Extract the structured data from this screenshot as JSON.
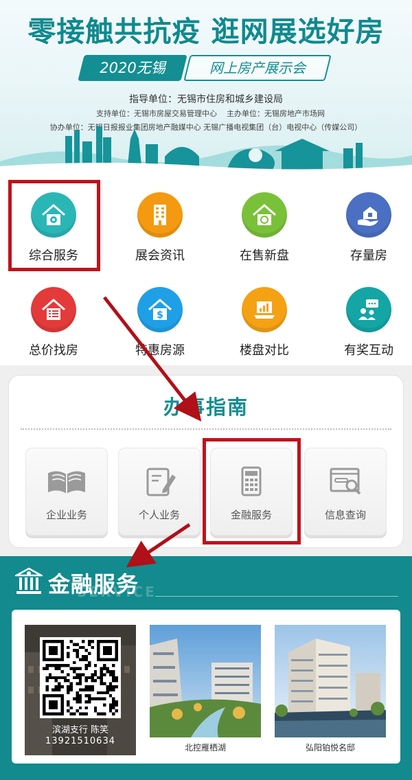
{
  "banner": {
    "title": "零接触共抗疫 逛网展选好房",
    "sub_left": "2020无锡",
    "sub_right": "网上房产展示会",
    "guide_unit": "指导单位：无锡市住房和城乡建设局",
    "support_unit": "支持单位：无锡市房屋交易管理中心",
    "host_unit": "主办单位：无锡房地产市场网",
    "co_units": "协办单位：无锡日报报业集团房地产融媒中心   无锡广播电视集团（台）电视中心（传媒公司）"
  },
  "grid": {
    "items": [
      {
        "label": "综合服务",
        "color": "#2bb6b6",
        "icon": "gear-house-icon"
      },
      {
        "label": "展会资讯",
        "color": "#f39a10",
        "icon": "building-icon"
      },
      {
        "label": "在售新盘",
        "color": "#7ac13a",
        "icon": "house-icon"
      },
      {
        "label": "存量房",
        "color": "#4b6fc2",
        "icon": "hand-house-icon"
      },
      {
        "label": "总价找房",
        "color": "#e33a3a",
        "icon": "list-house-icon"
      },
      {
        "label": "特惠房源",
        "color": "#1fa0e6",
        "icon": "dollar-house-icon"
      },
      {
        "label": "楼盘对比",
        "color": "#f5a114",
        "icon": "laptop-chart-icon"
      },
      {
        "label": "有奖互动",
        "color": "#14a5a5",
        "icon": "chat-people-icon"
      }
    ]
  },
  "guide": {
    "title": "办事指南",
    "buttons": [
      {
        "label": "企业业务",
        "icon": "open-book-icon"
      },
      {
        "label": "个人业务",
        "icon": "edit-note-icon"
      },
      {
        "label": "金融服务",
        "icon": "calculator-icon"
      },
      {
        "label": "信息查询",
        "icon": "search-window-icon"
      }
    ]
  },
  "finance": {
    "title": "金融服务",
    "watermark": "SERVICE",
    "cards": [
      {
        "line1": "滨湖支行 陈笑",
        "line2": "13921510634"
      },
      {
        "caption": "北控雁栖湖"
      },
      {
        "caption": "弘阳铂悦名邸"
      }
    ]
  },
  "colors": {
    "teal": "#138e92",
    "highlight_red": "#c0121c"
  }
}
